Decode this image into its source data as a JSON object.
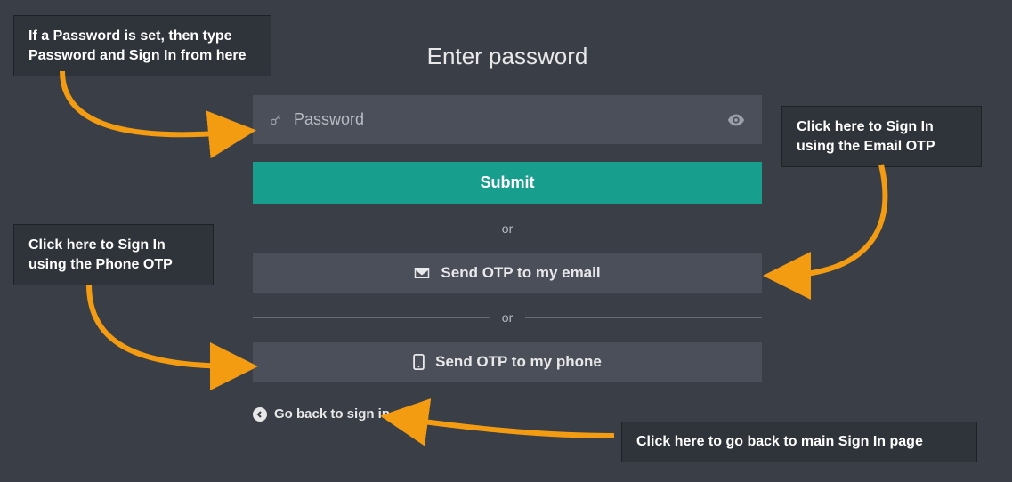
{
  "title": "Enter password",
  "password": {
    "placeholder": "Password",
    "value": ""
  },
  "submit_label": "Submit",
  "divider_text": "or",
  "email_otp_label": "Send OTP to my email",
  "phone_otp_label": "Send OTP to my phone",
  "go_back_label": "Go back to sign in",
  "callouts": {
    "password_hint": "If a Password is set, then type Password and Sign In from here",
    "email_hint": "Click here to Sign In using the Email OTP",
    "phone_hint": "Click here to Sign In using the Phone OTP",
    "back_hint": "Click here to go back to main Sign In page"
  },
  "colors": {
    "accent": "#179e8c",
    "arrow": "#f39c12"
  }
}
